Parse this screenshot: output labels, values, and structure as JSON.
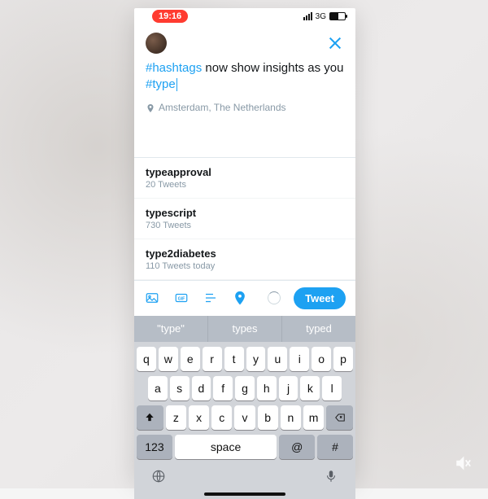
{
  "status": {
    "time": "19:16",
    "network": "3G"
  },
  "compose": {
    "text_pre": "#hashtags",
    "text_mid": " now show insights as you ",
    "text_hash": "#type",
    "location": "Amsterdam, The Netherlands"
  },
  "suggestions": [
    {
      "tag": "typeapproval",
      "count": "20 Tweets"
    },
    {
      "tag": "typescript",
      "count": "730 Tweets"
    },
    {
      "tag": "type2diabetes",
      "count": "110 Tweets today"
    }
  ],
  "toolbar": {
    "tweet": "Tweet"
  },
  "predictions": [
    "\"type\"",
    "types",
    "typed"
  ],
  "keys": {
    "r1": [
      "q",
      "w",
      "e",
      "r",
      "t",
      "y",
      "u",
      "i",
      "o",
      "p"
    ],
    "r2": [
      "a",
      "s",
      "d",
      "f",
      "g",
      "h",
      "j",
      "k",
      "l"
    ],
    "r3": [
      "z",
      "x",
      "c",
      "v",
      "b",
      "n",
      "m"
    ],
    "num": "123",
    "space": "space",
    "at": "@",
    "hash": "#"
  }
}
